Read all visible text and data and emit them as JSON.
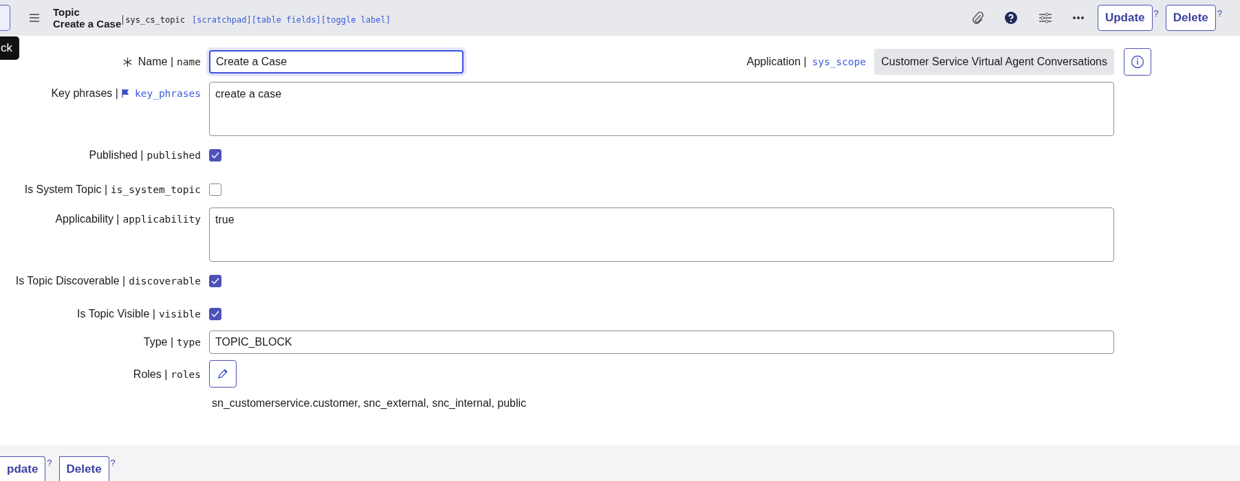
{
  "header": {
    "title": "Topic",
    "subtitle": "Create a Case",
    "table": "sys_cs_topic",
    "links": [
      "[scratchpad]",
      "[table fields]",
      "[toggle label]"
    ],
    "buttons": [
      {
        "label": "Update",
        "help": "?"
      },
      {
        "label": "Delete",
        "help": "?"
      }
    ]
  },
  "tooltip": "ck",
  "application": {
    "label": "Application |",
    "column": "sys_scope",
    "value": "Customer Service Virtual Agent Conversations"
  },
  "fields": [
    {
      "kind": "input",
      "label": "Name |",
      "column": "name",
      "required": true,
      "flagged": false,
      "focused": true,
      "value": "Create a Case"
    },
    {
      "kind": "textarea",
      "label": "Key phrases |",
      "column": "key_phrases",
      "required": false,
      "flagged": true,
      "value": "create a case"
    },
    {
      "kind": "checkbox",
      "label": "Published |",
      "column": "published",
      "required": false,
      "flagged": false,
      "checked": true
    },
    {
      "kind": "checkbox",
      "label": "Is System Topic |",
      "column": "is_system_topic",
      "required": false,
      "flagged": false,
      "checked": false
    },
    {
      "kind": "textarea",
      "label": "Applicability |",
      "column": "applicability",
      "required": false,
      "flagged": false,
      "value": "true"
    },
    {
      "kind": "checkbox",
      "label": "Is Topic Discoverable |",
      "column": "discoverable",
      "required": false,
      "flagged": false,
      "checked": true
    },
    {
      "kind": "checkbox",
      "label": "Is Topic Visible |",
      "column": "visible",
      "required": false,
      "flagged": false,
      "checked": true
    },
    {
      "kind": "input",
      "label": "Type |",
      "column": "type",
      "required": false,
      "flagged": false,
      "focused": false,
      "value": "TOPIC_BLOCK"
    },
    {
      "kind": "roles",
      "label": "Roles |",
      "column": "roles",
      "required": false,
      "flagged": false,
      "value": "sn_customerservice.customer, snc_external, snc_internal, public"
    }
  ],
  "footer_buttons": [
    {
      "label": "pdate",
      "help": "?"
    },
    {
      "label": "Delete",
      "help": "?"
    }
  ]
}
